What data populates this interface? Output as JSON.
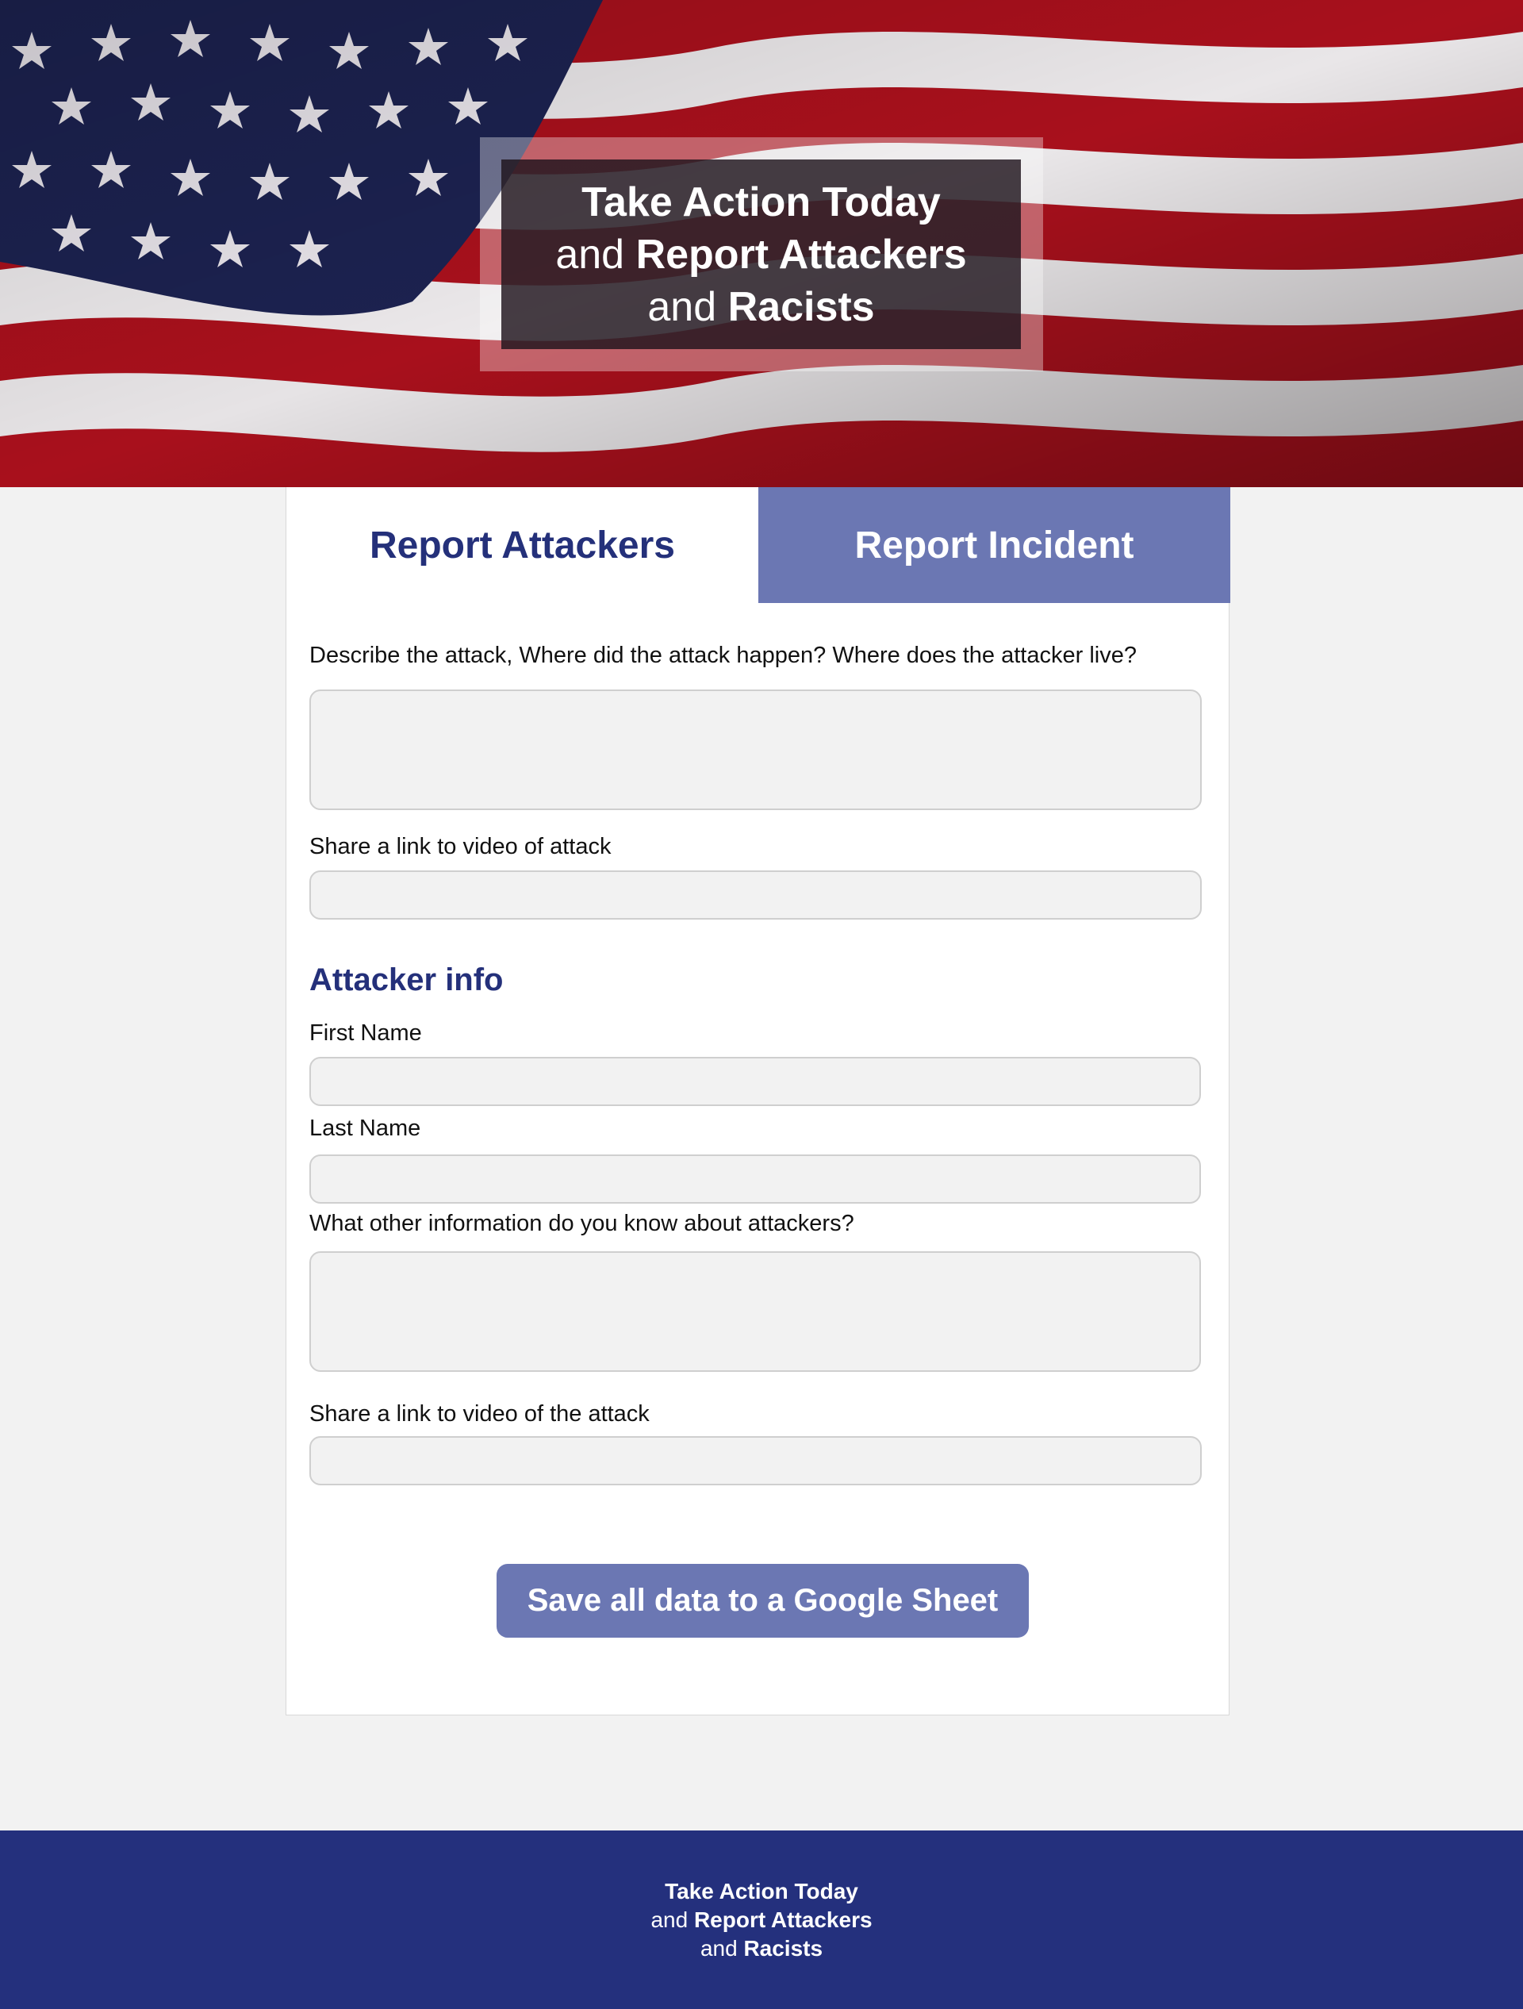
{
  "hero": {
    "line1_bold": "Take Action Today",
    "line2_thin": "and",
    "line2_bold": "Report Attackers",
    "line3_thin": "and",
    "line3_bold": "Racists"
  },
  "tabs": [
    {
      "label": "Report Attackers",
      "active": true
    },
    {
      "label": "Report Incident",
      "active": false
    }
  ],
  "form": {
    "describe_label": "Describe the attack, Where did the attack happen? Where does the attacker live?",
    "video_link_label": "Share a link to video of attack",
    "attacker_section_title": "Attacker info",
    "first_name_label": "First Name",
    "last_name_label": "Last Name",
    "other_info_label": "What other information do you know about attackers?",
    "video_link2_label": "Share a link to video of the attack",
    "describe_value": "",
    "video_link_value": "",
    "first_name_value": "",
    "last_name_value": "",
    "other_info_value": "",
    "video_link2_value": "",
    "save_button_label": "Save all data to a Google Sheet"
  },
  "footer": {
    "line1_bold": "Take Action Today",
    "line2_thin": "and",
    "line2_bold": "Report Attackers",
    "line3_thin": "and",
    "line3_bold": "Racists"
  },
  "colors": {
    "navy": "#24307a",
    "tab_inactive_bg": "#6b77b3",
    "page_bg": "#f2f2f2",
    "flag_red": "#b01522",
    "flag_blue": "#1e2450"
  },
  "icons": [
    "american-flag-image"
  ]
}
